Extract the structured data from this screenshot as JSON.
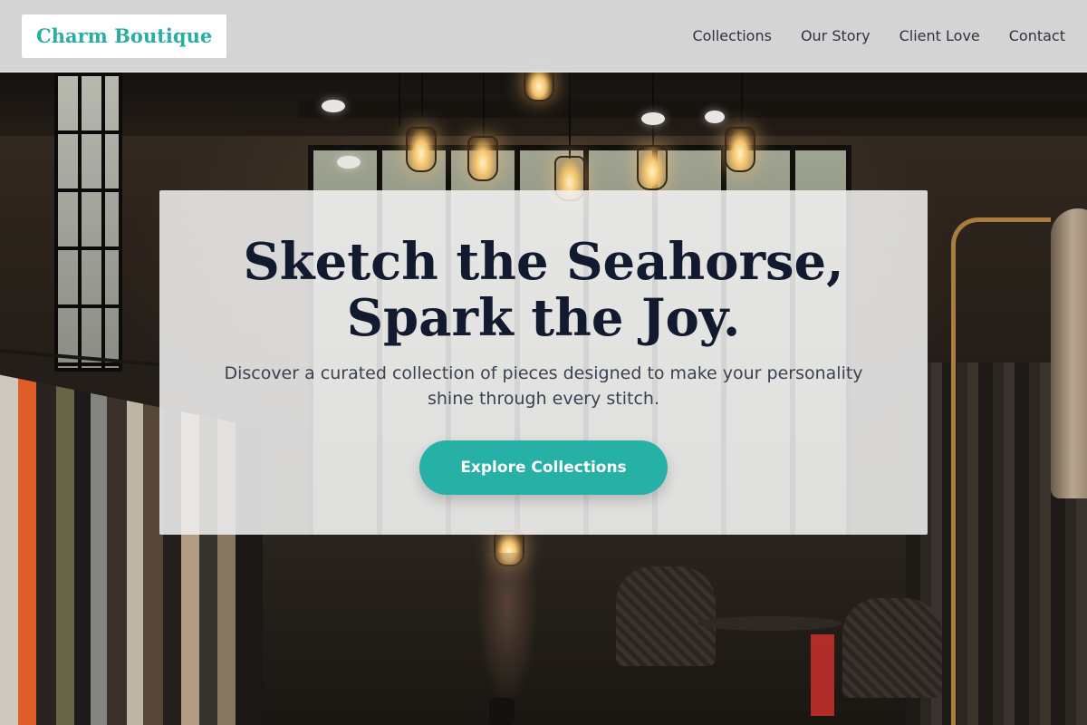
{
  "brand": {
    "name": "Charm Boutique",
    "color": "#2aaea3"
  },
  "nav": {
    "items": [
      {
        "label": "Collections"
      },
      {
        "label": "Our Story"
      },
      {
        "label": "Client Love"
      },
      {
        "label": "Contact"
      }
    ]
  },
  "hero": {
    "headline": "Sketch the Seahorse, Spark the Joy.",
    "subtext": "Discover a curated collection of pieces designed to make your personality shine through every stitch.",
    "cta_label": "Explore Collections",
    "cta_color": "#26b0a6",
    "headline_color": "#111a2e"
  }
}
